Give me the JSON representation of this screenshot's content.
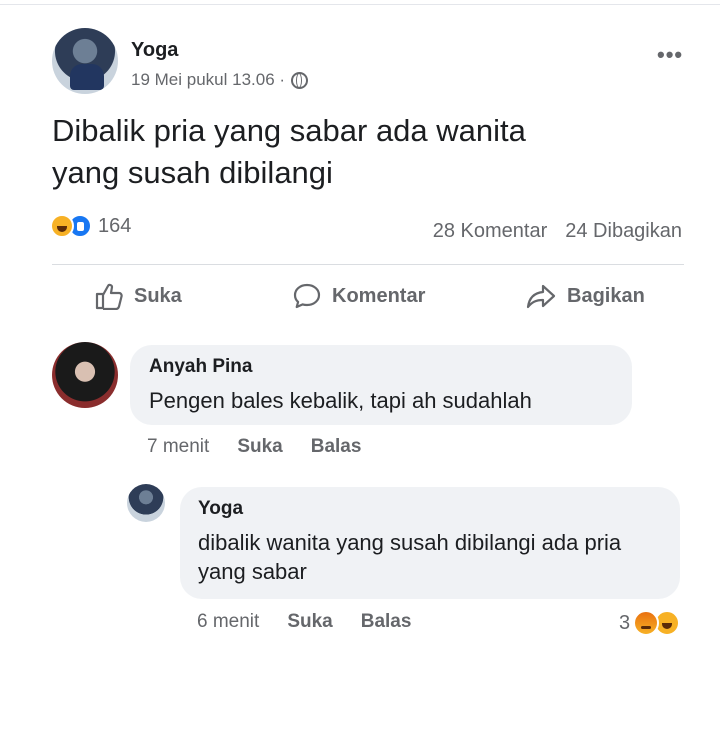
{
  "post": {
    "author": "Yoga",
    "timestamp": "19 Mei pukul 13.06 ·",
    "privacy_icon": "globe-icon",
    "menu_icon": "more-options-icon",
    "text_line1": "Dibalik pria yang sabar ada wanita",
    "text_line2": "yang susah dibilangi",
    "reaction_count": "164",
    "comments_count": "28 Komentar",
    "shares_count": "24 Dibagikan"
  },
  "actions": {
    "like": "Suka",
    "comment": "Komentar",
    "share": "Bagikan"
  },
  "comments": [
    {
      "author": "Anyah Pina",
      "text": "Pengen bales kebalik, tapi ah sudahlah",
      "time": "7 menit",
      "like": "Suka",
      "reply": "Balas"
    },
    {
      "author": "Yoga",
      "text": "dibalik wanita yang susah dibilangi ada pria yang sabar",
      "time": "6 menit",
      "like": "Suka",
      "reply": "Balas",
      "reaction_count": "3"
    }
  ],
  "colors": {
    "text": "#1c1e21",
    "secondary": "#65676b",
    "bubble": "#f0f2f5",
    "like_blue": "#1877f2"
  }
}
